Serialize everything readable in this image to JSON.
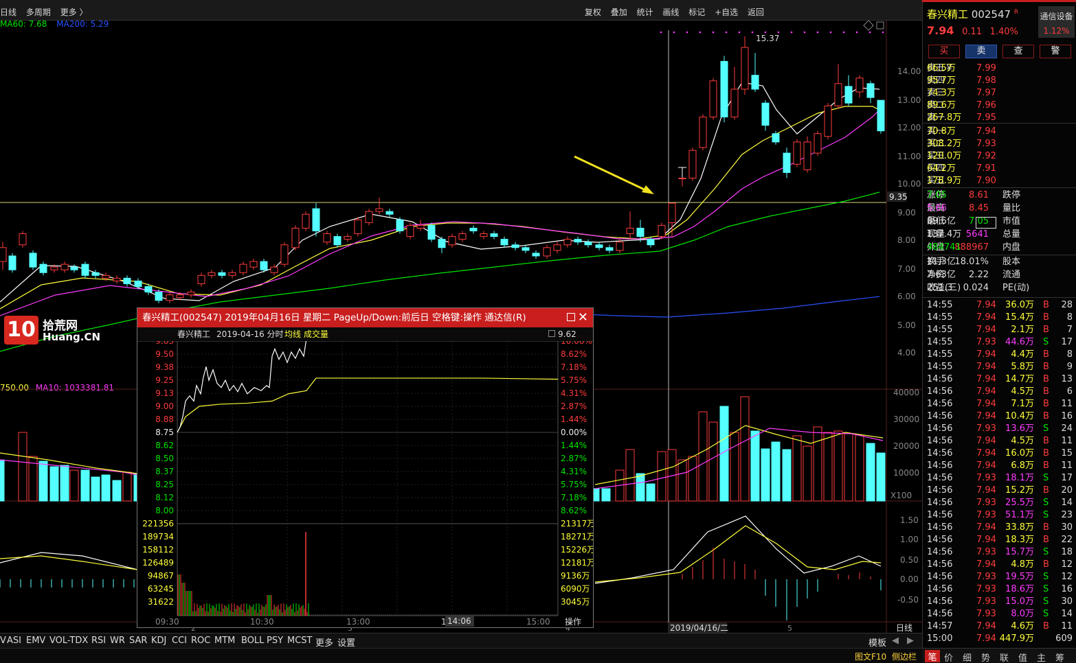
{
  "topbar": {
    "left_items": [
      "日线",
      "多周期",
      "更多 〉"
    ],
    "right_items": [
      "复权",
      "叠加",
      "统计",
      "画线",
      "标记",
      "+自选",
      "返回"
    ]
  },
  "ma_legend": {
    "ma60": "MA60: 7.68",
    "ma200": "MA200: 5.29"
  },
  "vol_legend": {
    "v1": "750.00",
    "ma10": "MA10: 1033381.81"
  },
  "price_axis": [
    "14.00",
    "13.00",
    "12.00",
    "11.00",
    "10.00",
    "9.00",
    "8.00",
    "7.00",
    "6.00",
    "5.00",
    "4.00"
  ],
  "price_marker": "9.35",
  "high_label": "15.37",
  "vol_axis": [
    "40000",
    "30000",
    "20000",
    "10000"
  ],
  "vol_unit": "X100",
  "macd_axis": [
    "1.50",
    "1.00",
    "0.50",
    "0.00",
    "-0.50"
  ],
  "date_cursor": "2019/04/16/二",
  "date_ticks": [
    "2",
    "3",
    "4",
    "5"
  ],
  "period_label": "日线",
  "watermark": {
    "logo": "10",
    "text1": "拾荒网",
    "text2": "Huang.CN"
  },
  "quote": {
    "name": "春兴精工",
    "code": "002547",
    "suffix": "R",
    "price": "7.94",
    "change": "0.11",
    "pct": "1.40%",
    "tongxin": "通信设备",
    "tongxin_pct": "1.12%",
    "tabs": [
      "买",
      "卖",
      "查",
      "警"
    ],
    "sell": [
      [
        "卖五￥",
        "7.99",
        "66.5万"
      ],
      [
        "卖四",
        "7.98",
        "95.7万"
      ],
      [
        "卖三",
        "7.97",
        "74.3万"
      ],
      [
        "卖二",
        "7.96",
        "89.6万"
      ],
      [
        "卖一",
        "7.95",
        "267.8万"
      ]
    ],
    "buy": [
      [
        "买一",
        "7.94",
        "70.8万"
      ],
      [
        "买二",
        "7.93",
        "308.2万"
      ],
      [
        "买三",
        "7.92",
        "120.0万"
      ],
      [
        "买四",
        "7.91",
        "64.2万"
      ],
      [
        "买五",
        "7.90",
        "178.9万"
      ]
    ],
    "stats1": [
      [
        "涨停",
        "8.61",
        "跌停",
        "7.05"
      ],
      [
        "最高",
        "8.45",
        "量比",
        "5.66"
      ],
      [
        "最低",
        "7.05",
        "市值",
        "89.6亿"
      ],
      [
        "现量",
        "5641",
        "总量",
        "137.4万"
      ],
      [
        "外盘",
        "888967",
        "内盘",
        "484741"
      ]
    ],
    "stats2": [
      [
        "换手",
        "18.01%",
        "股本",
        "11.3亿"
      ],
      [
        "净资",
        "2.22",
        "流通",
        "7.63亿"
      ],
      [
        "收益(三)",
        "0.024",
        "PE(动)",
        "251.3"
      ]
    ]
  },
  "ticks": [
    [
      "14:55",
      "7.94",
      "36.0万",
      "B",
      "28"
    ],
    [
      "14:55",
      "7.94",
      "15.4万",
      "B",
      "8"
    ],
    [
      "14:55",
      "7.94",
      "2.1万",
      "B",
      "7"
    ],
    [
      "14:55",
      "7.93",
      "44.6万",
      "S",
      "17"
    ],
    [
      "14:55",
      "7.94",
      "4.4万",
      "B",
      "8"
    ],
    [
      "14:55",
      "7.94",
      "5.8万",
      "B",
      "9"
    ],
    [
      "14:56",
      "7.94",
      "14.7万",
      "B",
      "13"
    ],
    [
      "14:56",
      "7.94",
      "4.5万",
      "B",
      "6"
    ],
    [
      "14:56",
      "7.94",
      "7.1万",
      "B",
      "11"
    ],
    [
      "14:56",
      "7.94",
      "10.4万",
      "B",
      "16"
    ],
    [
      "14:56",
      "7.93",
      "13.6万",
      "S",
      "24"
    ],
    [
      "14:56",
      "7.94",
      "4.5万",
      "B",
      "11"
    ],
    [
      "14:56",
      "7.94",
      "16.0万",
      "B",
      "15"
    ],
    [
      "14:56",
      "7.94",
      "6.8万",
      "B",
      "11"
    ],
    [
      "14:56",
      "7.93",
      "18.1万",
      "S",
      "17"
    ],
    [
      "14:56",
      "7.94",
      "15.2万",
      "B",
      "20"
    ],
    [
      "14:56",
      "7.93",
      "25.5万",
      "S",
      "14"
    ],
    [
      "14:56",
      "7.93",
      "51.1万",
      "S",
      "23"
    ],
    [
      "14:56",
      "7.94",
      "33.8万",
      "B",
      "30"
    ],
    [
      "14:56",
      "7.94",
      "18.3万",
      "B",
      "22"
    ],
    [
      "14:56",
      "7.93",
      "15.7万",
      "S",
      "18"
    ],
    [
      "14:56",
      "7.94",
      "4.8万",
      "B",
      "12"
    ],
    [
      "14:56",
      "7.93",
      "19.5万",
      "S",
      "12"
    ],
    [
      "14:56",
      "7.93",
      "18.6万",
      "S",
      "16"
    ],
    [
      "14:56",
      "7.93",
      "15.0万",
      "S",
      "30"
    ],
    [
      "14:56",
      "7.93",
      "8.0万",
      "S",
      "14"
    ],
    [
      "14:57",
      "7.94",
      "4.6万",
      "B",
      "11"
    ],
    [
      "15:00",
      "7.94",
      "447.9万",
      "",
      "609"
    ]
  ],
  "bottom_tabs": [
    "V",
    "ASI",
    "EMV",
    "VOL-TDX",
    "RSI",
    "WR",
    "SAR",
    "KDJ",
    "CCI",
    "ROC",
    "MTM",
    "BOLL",
    "PSY",
    "MCST",
    "更多",
    "设置"
  ],
  "bottom_right": [
    "模板",
    "◀",
    "▶"
  ],
  "status": {
    "f10": "图文F10",
    "side": "侧边栏"
  },
  "rp_bottom": [
    "笔",
    "价",
    "细",
    "势",
    "联",
    "值",
    "主",
    "筹"
  ],
  "popup": {
    "title": "春兴精工(002547) 2019年04月16日 星期二 PageUp/Down:前后日 空格键:操作 通达信(R)",
    "sub_name": "春兴精工",
    "sub_date": "2019-04-16 分时",
    "sub_avg": "均线",
    "sub_vol": "成交量",
    "price_marker": "9.62",
    "left_axis": [
      "9.63",
      "9.50",
      "9.38",
      "9.25",
      "9.13",
      "9.00",
      "8.88",
      "8.75",
      "8.62",
      "8.50",
      "8.37",
      "8.25",
      "8.12",
      "8.00"
    ],
    "right_axis": [
      "10.06%",
      "8.62%",
      "7.18%",
      "5.75%",
      "4.31%",
      "2.87%",
      "1.44%",
      "0.00%",
      "1.44%",
      "2.87%",
      "4.31%",
      "5.75%",
      "7.18%",
      "8.62%"
    ],
    "vol_left": [
      "221356",
      "189734",
      "158112",
      "126489",
      "94867",
      "63245",
      "31622"
    ],
    "vol_right": [
      "21317万",
      "18271万",
      "15226万",
      "12181万",
      "9136万",
      "6090万",
      "3045万"
    ],
    "time_axis": [
      "09:30",
      "10:30",
      "13:00",
      "14:06",
      "15:00"
    ],
    "op": "操作"
  },
  "colors": {
    "red": "#ff3c3c",
    "green": "#00e600",
    "cyan": "#54ffff",
    "yellow": "#ffff3c",
    "magenta": "#ff3cff",
    "blue": "#2850ff",
    "white": "#ffffff"
  }
}
